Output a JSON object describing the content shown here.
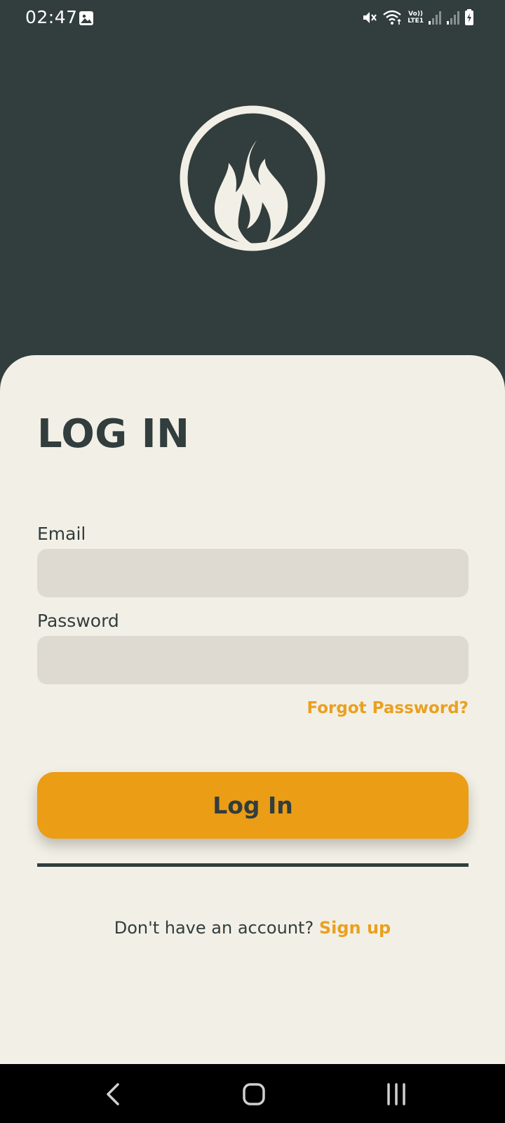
{
  "status_bar": {
    "time": "02:47",
    "icons": [
      "gallery-icon",
      "mute-icon",
      "wifi-icon",
      "volte-icon",
      "signal-icon",
      "signal-icon",
      "battery-charging-icon"
    ],
    "volte_top": "Vo))",
    "volte_bottom": "LTE1"
  },
  "brand": {
    "logo_icon": "flame-icon"
  },
  "login": {
    "title": "LOG IN",
    "email_label": "Email",
    "email_value": "",
    "password_label": "Password",
    "password_value": "",
    "forgot_password": "Forgot Password?",
    "login_button": "Log In",
    "signup_prompt": "Don't have an account?",
    "signup_link": "Sign up"
  },
  "nav_bar": {
    "icons": [
      "back-icon",
      "home-icon",
      "recents-icon"
    ]
  },
  "colors": {
    "dark": "#323d3d",
    "cream": "#f2f0e6",
    "input": "#dedad2",
    "accent": "#eb9d16"
  }
}
